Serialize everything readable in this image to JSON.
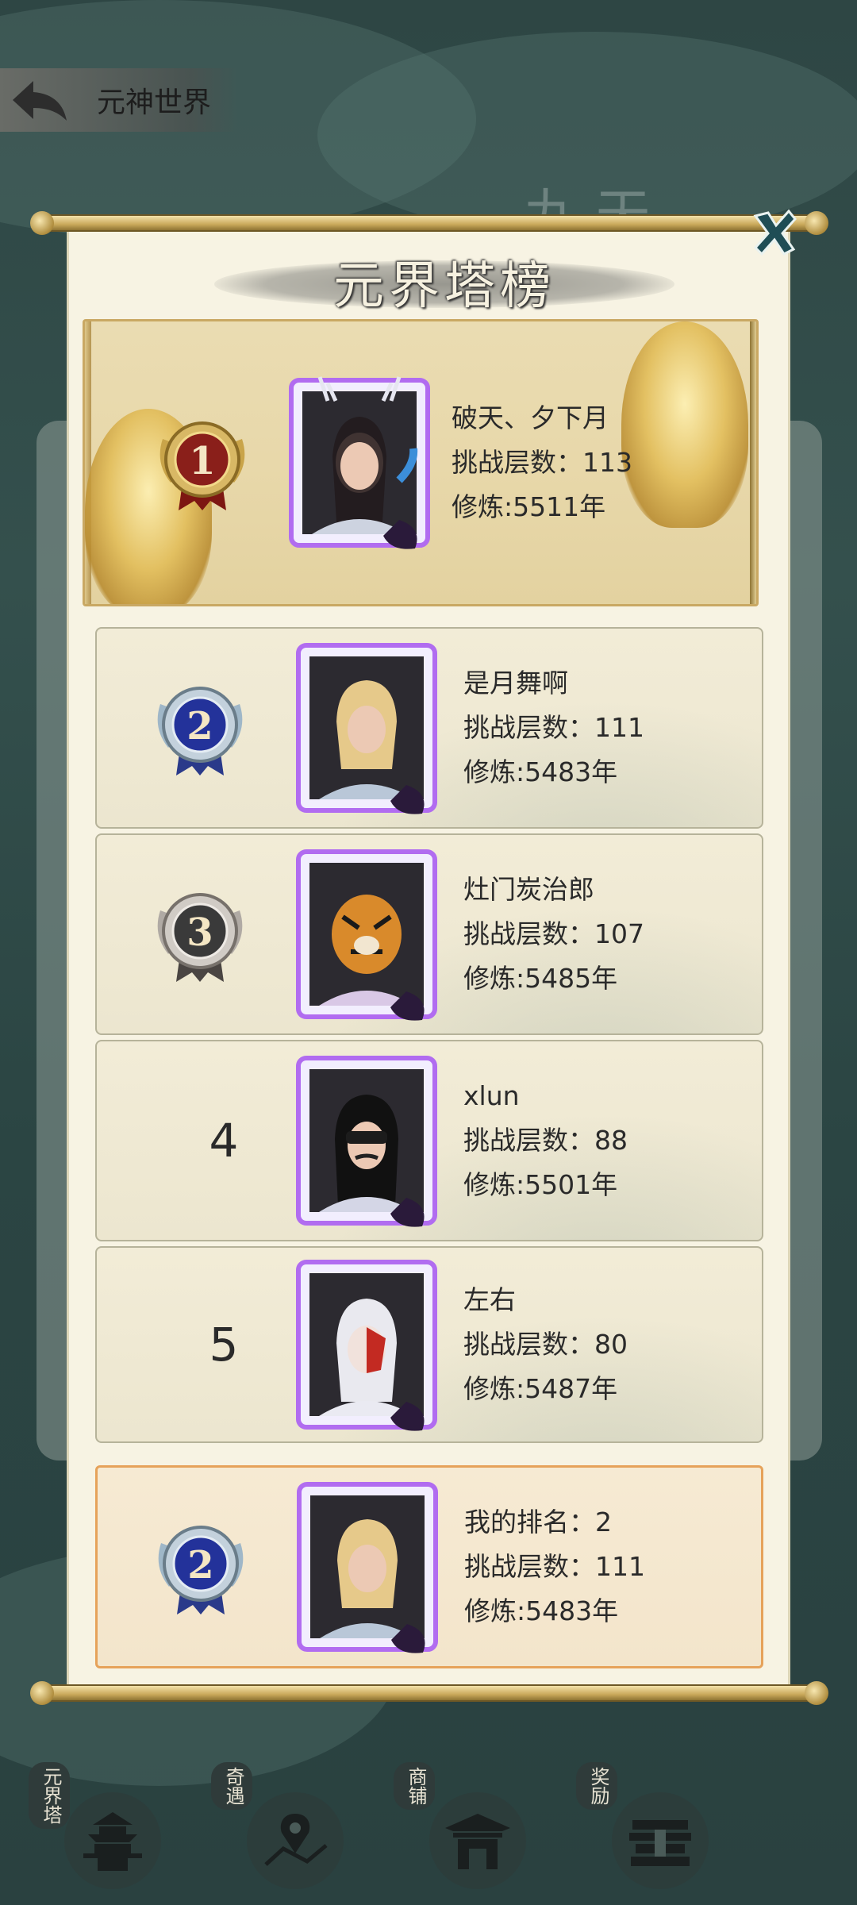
{
  "header": {
    "title": "元神世界"
  },
  "panel": {
    "title": "元界塔榜"
  },
  "labels": {
    "floors": "挑战层数：",
    "cultivation": "修炼:",
    "year_unit": "年"
  },
  "leaderboard": [
    {
      "rank": "1",
      "name": "破天、夕下月",
      "floors": "挑战层数：113",
      "cultivation": "修炼:5511年"
    },
    {
      "rank": "2",
      "name": "是月舞啊",
      "floors": "挑战层数：111",
      "cultivation": "修炼:5483年"
    },
    {
      "rank": "3",
      "name": "灶门炭治郎",
      "floors": "挑战层数：107",
      "cultivation": "修炼:5485年"
    },
    {
      "rank": "4",
      "name": "xlun",
      "floors": "挑战层数：88",
      "cultivation": "修炼:5501年"
    },
    {
      "rank": "5",
      "name": "左右",
      "floors": "挑战层数：80",
      "cultivation": "修炼:5487年"
    }
  ],
  "my_rank": {
    "rank": "2",
    "label": "我的排名：2",
    "floors": "挑战层数：111",
    "cultivation": "修炼:5483年"
  },
  "bottom_nav": [
    {
      "label": "元界塔",
      "icon": "tower-icon"
    },
    {
      "label": "奇遇",
      "icon": "map-pin-icon"
    },
    {
      "label": "商铺",
      "icon": "shop-icon"
    },
    {
      "label": "奖励",
      "icon": "reward-chest-icon"
    }
  ],
  "colors": {
    "gold_medal": "#8a1f1a",
    "silver_medal": "#23329a",
    "bronze_medal": "#3a3a3a",
    "my_rank_border": "#e6a25a"
  }
}
